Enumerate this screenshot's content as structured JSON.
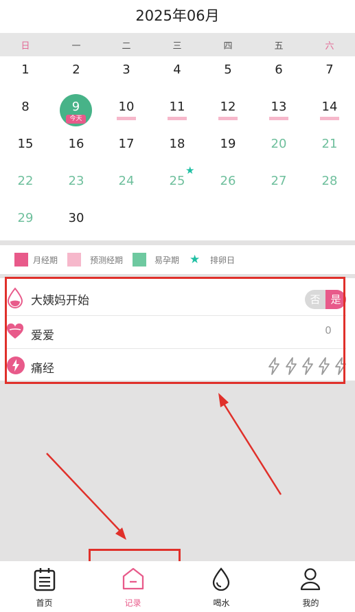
{
  "header": {
    "month_title": "2025年06月"
  },
  "weekdays": [
    "日",
    "一",
    "二",
    "三",
    "四",
    "五",
    "六"
  ],
  "calendar": {
    "rows": [
      [
        "1",
        "2",
        "3",
        "4",
        "5",
        "6",
        "7"
      ],
      [
        "8",
        "9",
        "10",
        "11",
        "12",
        "13",
        "14"
      ],
      [
        "15",
        "16",
        "17",
        "18",
        "19",
        "20",
        "21"
      ],
      [
        "22",
        "23",
        "24",
        "25",
        "26",
        "27",
        "28"
      ],
      [
        "29",
        "30"
      ]
    ],
    "today_label": "今天"
  },
  "legend": {
    "period": "月经期",
    "predicted": "预测经期",
    "fertile": "易孕期",
    "ovulation": "排卵日"
  },
  "records": {
    "period_start": {
      "label": "大姨妈开始",
      "no": "否",
      "yes": "是"
    },
    "love": {
      "label": "爱爱",
      "count": "0"
    },
    "cramps": {
      "label": "痛经"
    }
  },
  "nav": {
    "home": "首页",
    "record": "记录",
    "water": "喝水",
    "mine": "我的"
  },
  "colors": {
    "period": "#e85a8a",
    "predicted": "#f6b8cb",
    "fertile": "#6ebf9c",
    "ovulation_star": "#1fbfa3",
    "highlight": "#e0302a"
  }
}
